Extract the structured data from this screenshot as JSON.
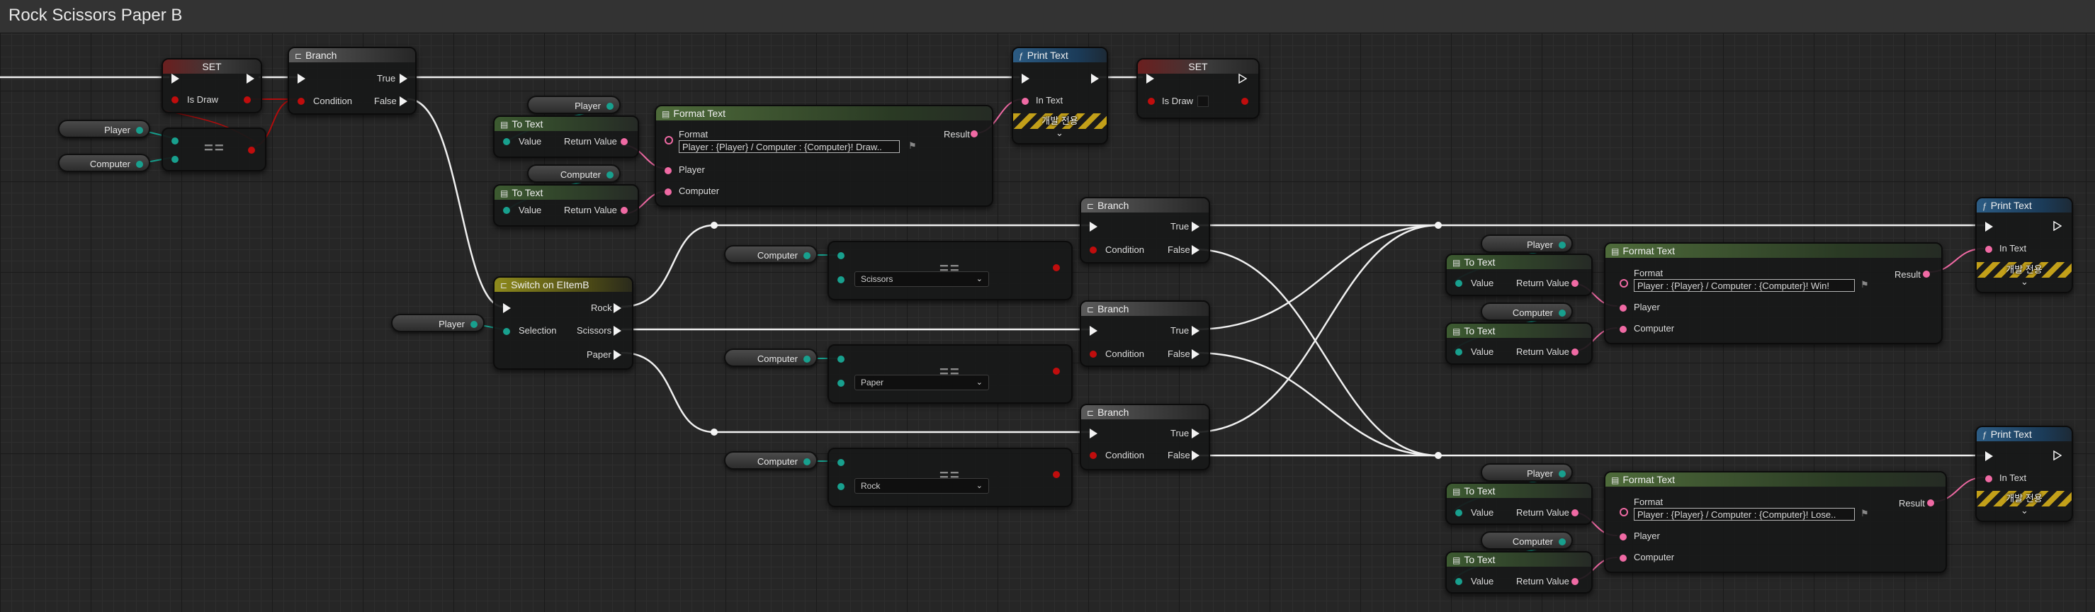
{
  "graph": {
    "title": "Rock Scissors Paper B"
  },
  "labels": {
    "set": "SET",
    "branch": "Branch",
    "print_text": "Print Text",
    "format_text": "Format Text",
    "to_text": "To Text",
    "switch": "Switch on EItemB",
    "true": "True",
    "false": "False",
    "condition": "Condition",
    "is_draw": "Is Draw",
    "in_text": "In Text",
    "format": "Format",
    "result": "Result",
    "value": "Value",
    "return_value": "Return Value",
    "player": "Player",
    "computer": "Computer",
    "selection": "Selection",
    "rock": "Rock",
    "scissors": "Scissors",
    "paper": "Paper",
    "equals": "==",
    "dev_only": "개발 전용"
  },
  "variables": {
    "player": "Player",
    "computer": "Computer"
  },
  "format_strings": {
    "draw": "Player : {Player} / Computer : {Computer}! Draw..",
    "win": "Player : {Player} / Computer : {Computer}! Win!",
    "lose": "Player : {Player} / Computer : {Computer}! Lose.."
  },
  "enum_options": {
    "scissors": "Scissors",
    "paper": "Paper",
    "rock": "Rock"
  },
  "pin_colors": {
    "exec": "#f2f2f2",
    "bool": "#c00d0d",
    "enum": "#18a08e",
    "text": "#f06aa4"
  }
}
